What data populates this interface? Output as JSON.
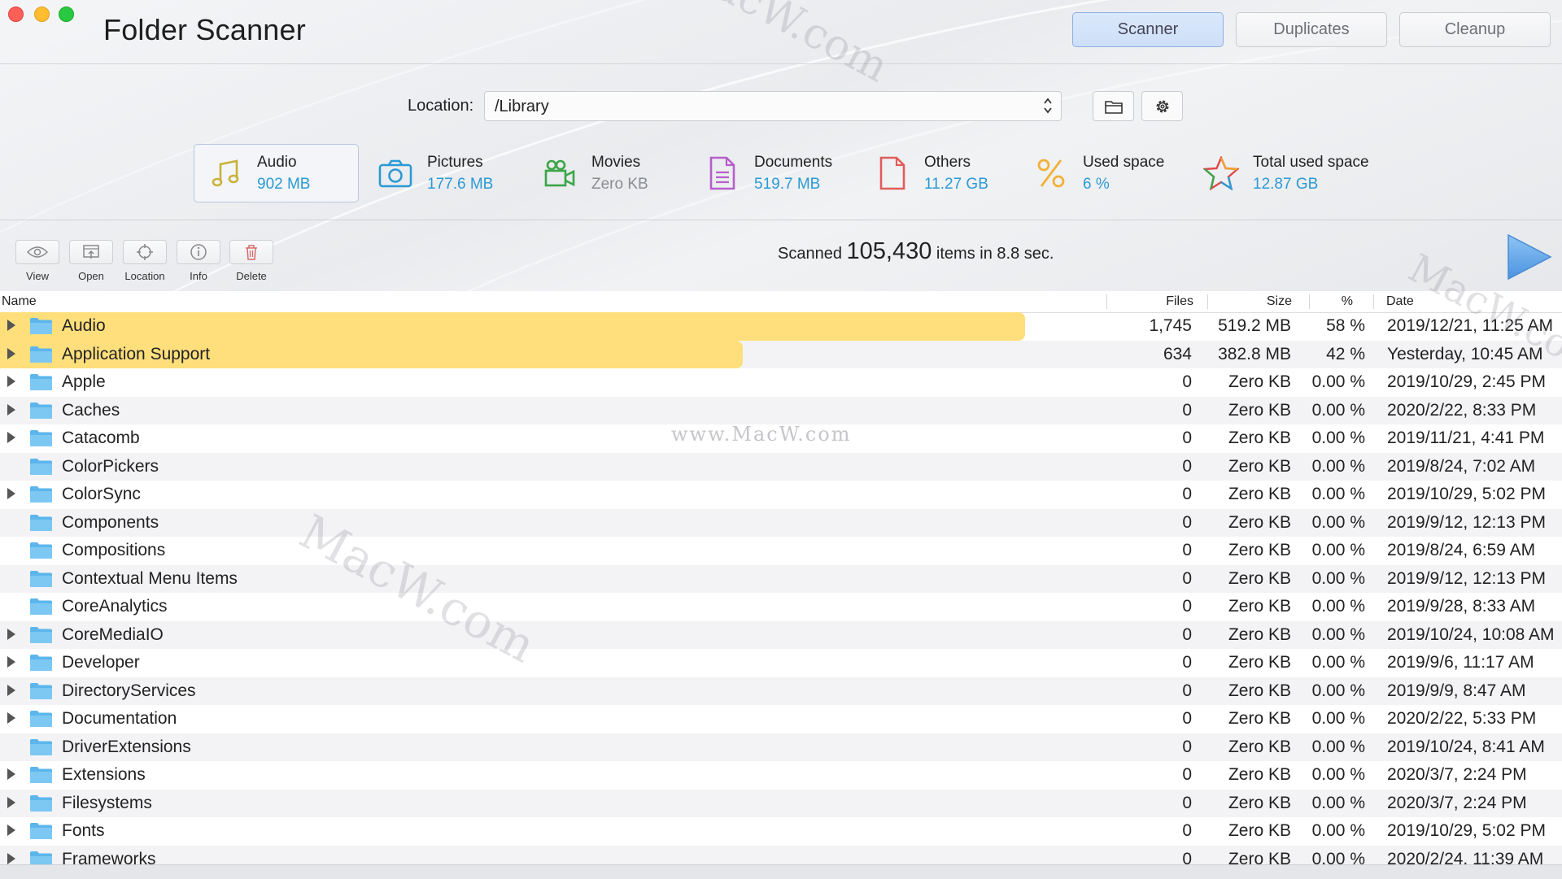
{
  "window": {
    "title": "Folder Scanner",
    "tabs": [
      "Scanner",
      "Duplicates",
      "Cleanup"
    ],
    "active_tab": "Scanner"
  },
  "location": {
    "label": "Location:",
    "value": "/Library",
    "browse_icon": "folder-icon",
    "settings_icon": "gear-icon"
  },
  "stats": [
    {
      "label": "Audio",
      "value": "902 MB",
      "icon": "music-note-icon",
      "color": "#c8b23a"
    },
    {
      "label": "Pictures",
      "value": "177.6 MB",
      "icon": "camera-icon",
      "color": "#2b9ad4"
    },
    {
      "label": "Movies",
      "value": "Zero KB",
      "icon": "video-camera-icon",
      "color": "#3aa548"
    },
    {
      "label": "Documents",
      "value": "519.7 MB",
      "icon": "document-icon",
      "color": "#b560c9"
    },
    {
      "label": "Others",
      "value": "11.27 GB",
      "icon": "file-icon",
      "color": "#e25b5b"
    },
    {
      "label": "Used space",
      "value": "6 %",
      "icon": "percent-icon",
      "color": "#f0b23a"
    },
    {
      "label": "Total used space",
      "value": "12.87 GB",
      "icon": "star-icon",
      "color": "#e04848"
    }
  ],
  "toolbar": {
    "view": "View",
    "open": "Open",
    "location": "Location",
    "info": "Info",
    "delete": "Delete"
  },
  "summary": {
    "prefix": "Scanned",
    "count": "105,430",
    "suffix": "items in 8.8 sec."
  },
  "table": {
    "columns": {
      "name": "Name",
      "files": "Files",
      "size": "Size",
      "percent": "%",
      "date": "Date"
    },
    "rows": [
      {
        "name": "Audio",
        "files": "1,745",
        "size": "519.2 MB",
        "percent": "58 %",
        "date": "2019/12/21, 11:25 AM",
        "expandable": true,
        "fraction": 0.58
      },
      {
        "name": "Application Support",
        "files": "634",
        "size": "382.8 MB",
        "percent": "42 %",
        "date": "Yesterday, 10:45 AM",
        "expandable": true,
        "fraction": 0.42
      },
      {
        "name": "Apple",
        "files": "0",
        "size": "Zero KB",
        "percent": "0.00 %",
        "date": "2019/10/29, 2:45 PM",
        "expandable": true,
        "fraction": 0
      },
      {
        "name": "Caches",
        "files": "0",
        "size": "Zero KB",
        "percent": "0.00 %",
        "date": "2020/2/22, 8:33 PM",
        "expandable": true,
        "fraction": 0
      },
      {
        "name": "Catacomb",
        "files": "0",
        "size": "Zero KB",
        "percent": "0.00 %",
        "date": "2019/11/21, 4:41 PM",
        "expandable": true,
        "fraction": 0
      },
      {
        "name": "ColorPickers",
        "files": "0",
        "size": "Zero KB",
        "percent": "0.00 %",
        "date": "2019/8/24, 7:02 AM",
        "expandable": false,
        "fraction": 0
      },
      {
        "name": "ColorSync",
        "files": "0",
        "size": "Zero KB",
        "percent": "0.00 %",
        "date": "2019/10/29, 5:02 PM",
        "expandable": true,
        "fraction": 0
      },
      {
        "name": "Components",
        "files": "0",
        "size": "Zero KB",
        "percent": "0.00 %",
        "date": "2019/9/12, 12:13 PM",
        "expandable": false,
        "fraction": 0
      },
      {
        "name": "Compositions",
        "files": "0",
        "size": "Zero KB",
        "percent": "0.00 %",
        "date": "2019/8/24, 6:59 AM",
        "expandable": false,
        "fraction": 0
      },
      {
        "name": "Contextual Menu Items",
        "files": "0",
        "size": "Zero KB",
        "percent": "0.00 %",
        "date": "2019/9/12, 12:13 PM",
        "expandable": false,
        "fraction": 0
      },
      {
        "name": "CoreAnalytics",
        "files": "0",
        "size": "Zero KB",
        "percent": "0.00 %",
        "date": "2019/9/28, 8:33 AM",
        "expandable": false,
        "fraction": 0
      },
      {
        "name": "CoreMediaIO",
        "files": "0",
        "size": "Zero KB",
        "percent": "0.00 %",
        "date": "2019/10/24, 10:08 AM",
        "expandable": true,
        "fraction": 0
      },
      {
        "name": "Developer",
        "files": "0",
        "size": "Zero KB",
        "percent": "0.00 %",
        "date": "2019/9/6, 11:17 AM",
        "expandable": true,
        "fraction": 0
      },
      {
        "name": "DirectoryServices",
        "files": "0",
        "size": "Zero KB",
        "percent": "0.00 %",
        "date": "2019/9/9, 8:47 AM",
        "expandable": true,
        "fraction": 0
      },
      {
        "name": "Documentation",
        "files": "0",
        "size": "Zero KB",
        "percent": "0.00 %",
        "date": "2020/2/22, 5:33 PM",
        "expandable": true,
        "fraction": 0
      },
      {
        "name": "DriverExtensions",
        "files": "0",
        "size": "Zero KB",
        "percent": "0.00 %",
        "date": "2019/10/24, 8:41 AM",
        "expandable": false,
        "fraction": 0
      },
      {
        "name": "Extensions",
        "files": "0",
        "size": "Zero KB",
        "percent": "0.00 %",
        "date": "2020/3/7, 2:24 PM",
        "expandable": true,
        "fraction": 0
      },
      {
        "name": "Filesystems",
        "files": "0",
        "size": "Zero KB",
        "percent": "0.00 %",
        "date": "2020/3/7, 2:24 PM",
        "expandable": true,
        "fraction": 0
      },
      {
        "name": "Fonts",
        "files": "0",
        "size": "Zero KB",
        "percent": "0.00 %",
        "date": "2019/10/29, 5:02 PM",
        "expandable": true,
        "fraction": 0
      },
      {
        "name": "Frameworks",
        "files": "0",
        "size": "Zero KB",
        "percent": "0.00 %",
        "date": "2020/2/24, 11:39 AM",
        "expandable": true,
        "fraction": 0
      }
    ]
  },
  "watermarks": [
    "MacW.com",
    "www.MacW.com",
    "MacW.com",
    "MacW.com"
  ],
  "colors": {
    "accent": "#2b9ad4",
    "size_bar": "#fedf7c",
    "play": "#5aa2e8"
  }
}
